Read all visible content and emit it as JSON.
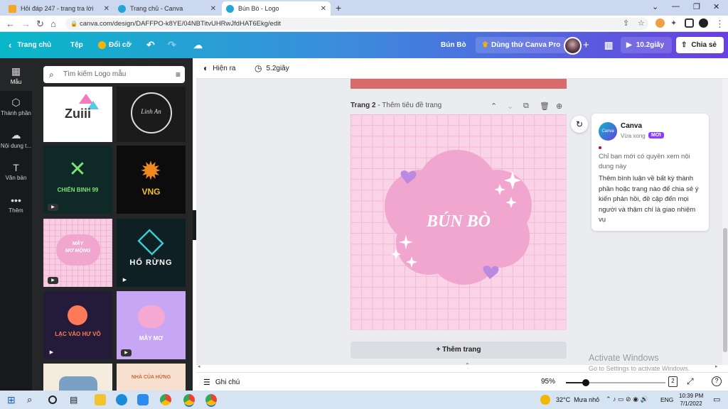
{
  "browser": {
    "tabs": [
      {
        "title": "Hỏi đáp 247 - trang tra lời",
        "favicon_color": "#f5a623"
      },
      {
        "title": "Trang chủ - Canva",
        "favicon_color": "#22a6d6"
      },
      {
        "title": "Bún Bò - Logo",
        "favicon_color": "#22a6d6",
        "active": true
      }
    ],
    "new_tab": "+",
    "url": "canva.com/design/DAFFPO-k8YE/04NBTitvUHRwJfdHAT6Ekg/edit"
  },
  "header": {
    "home": "Trang chủ",
    "file": "Tệp",
    "resize": "Đổi cỡ",
    "design_title": "Bún Bò",
    "trial": "Dùng thử Canva Pro",
    "add": "+",
    "play_time": "10.2giây",
    "share": "Chia sẻ"
  },
  "rail": [
    {
      "label": "Mẫu",
      "icon": "template-icon"
    },
    {
      "label": "Thành phần",
      "icon": "elements-icon"
    },
    {
      "label": "Nội dung t...",
      "icon": "upload-icon"
    },
    {
      "label": "Văn bản",
      "icon": "text-icon"
    },
    {
      "label": "Thêm",
      "icon": "more-icon"
    }
  ],
  "panel": {
    "search_placeholder": "Tìm kiếm Logo mẫu",
    "templates": [
      {
        "text": "Zuiii",
        "sub": "",
        "bg": "#ffffff",
        "fg": "#333333",
        "video": false
      },
      {
        "text": "Linh An",
        "sub": "",
        "bg": "#1b1b1b",
        "fg": "#dddddd",
        "video": false
      },
      {
        "text": "CHIẾN BINH 99",
        "sub": "",
        "bg": "#0f2a26",
        "fg": "#7de07a",
        "video": true
      },
      {
        "text": "VNG",
        "sub": "",
        "bg": "#0c0c0c",
        "fg": "#f4c020",
        "video": false
      },
      {
        "text": "MÂY",
        "sub": "MƠ MỘNG",
        "bg": "#f8cde2",
        "fg": "#ffffff",
        "video": true
      },
      {
        "text": "HỔ RỪNG",
        "sub": "",
        "bg": "#0e2024",
        "fg": "#ffffff",
        "video": true
      },
      {
        "text": "LẠC VÀO HƯ VÔ",
        "sub": "",
        "bg": "#241a3a",
        "fg": "#ff7a59",
        "video": true
      },
      {
        "text": "MÂY MƠ",
        "sub": "",
        "bg": "#c7a6f5",
        "fg": "#ffffff",
        "video": true
      },
      {
        "text": "",
        "sub": "",
        "bg": "#f6ecdd",
        "fg": "#7aa0c4",
        "video": false
      },
      {
        "text": "NHÀ CỦA HỪNG",
        "sub": "",
        "bg": "#f8e0d0",
        "fg": "#c96a3a",
        "video": false
      }
    ]
  },
  "toolbar": {
    "animate": "Hiện ra",
    "duration": "5.2giây"
  },
  "page": {
    "label": "Trang 2",
    "title_placeholder": "Thêm tiêu đề trang",
    "logo_text": "BÚN BÒ",
    "add_page": "+ Thêm trang"
  },
  "comment": {
    "author": "Canva",
    "time": "Vừa xong",
    "badge": "MỚI",
    "notice": "Chỉ bạn mới có quyền xem nội dung này",
    "body": "Thêm bình luận về bất kỳ thành phần hoặc trang nào để chia sẻ ý kiến phản hồi, đề cập đến mọi người và thậm chí là giao nhiệm vụ"
  },
  "bottom": {
    "notes": "Ghi chú",
    "zoom": "95%",
    "zoom_fraction": 0.2,
    "page_count": "2"
  },
  "watermark": {
    "title": "Activate Windows",
    "sub": "Go to Settings to activate Windows."
  },
  "taskbar": {
    "weather": "32°C  Mưa nhỏ",
    "lang": "ENG",
    "time": "10:39 PM",
    "date": "7/1/2022"
  },
  "colors": {
    "accent": "#8b3dff",
    "canvas_pink": "#fbd3e6",
    "cloud_pink": "#f0a6cf",
    "prev_page": "#d96b6b"
  }
}
